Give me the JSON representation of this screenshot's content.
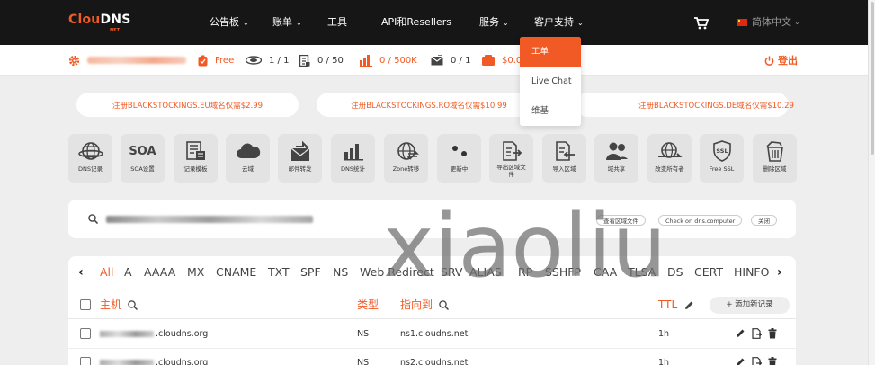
{
  "header": {
    "logo": "ClouDNS",
    "logo_sub": "NET",
    "nav": [
      {
        "label": "公告板",
        "chevron": true
      },
      {
        "label": "账单",
        "chevron": true
      },
      {
        "label": "工具",
        "chevron": false
      },
      {
        "label": "API和Resellers",
        "chevron": false
      },
      {
        "label": "服务",
        "chevron": true
      },
      {
        "label": "客户支持",
        "chevron": true
      }
    ],
    "language": "简体中文"
  },
  "status": {
    "plan": "Free",
    "zones": "1 / 1",
    "records": "0 / 50",
    "queries": "0 / 500K",
    "mail": "0 / 1",
    "balance": "$0.0",
    "logout": "登出"
  },
  "promos": [
    "注册BLACKSTOCKINGS.EU域名仅需$2.99",
    "注册BLACKSTOCKINGS.RO域名仅需$10.99",
    "注册BLACKSTOCKINGS.DE域名仅需$10.29"
  ],
  "support_menu": [
    "工单",
    "Live Chat",
    "维基"
  ],
  "tiles": [
    {
      "icon": "globe-icon",
      "label": "DNS记录"
    },
    {
      "icon": "soa-icon",
      "label": "SOA设置",
      "text": "SOA"
    },
    {
      "icon": "template-icon",
      "label": "记录模板"
    },
    {
      "icon": "cloud-icon",
      "label": "云域"
    },
    {
      "icon": "mail-forward-icon",
      "label": "邮件转发"
    },
    {
      "icon": "bar-chart-icon",
      "label": "DNS统计"
    },
    {
      "icon": "globe-transfer-icon",
      "label": "Zone转移"
    },
    {
      "icon": "dots-icon",
      "label": "更新中"
    },
    {
      "icon": "export-icon",
      "label": "导出区域文件"
    },
    {
      "icon": "import-icon",
      "label": "导入区域"
    },
    {
      "icon": "users-icon",
      "label": "域共享"
    },
    {
      "icon": "change-owner-icon",
      "label": "改变所有者"
    },
    {
      "icon": "ssl-icon",
      "label": "Free SSL"
    },
    {
      "icon": "trash-icon",
      "label": "删除区域"
    }
  ],
  "search": {
    "buttons": [
      "查看区域文件",
      "Check on dns.computer",
      "关闭"
    ]
  },
  "record_tabs": [
    "All",
    "A",
    "AAAA",
    "MX",
    "CNAME",
    "TXT",
    "SPF",
    "NS",
    "Web Redirect",
    "SRV",
    "ALIAS",
    "RP",
    "SSHFP",
    "CAA",
    "TLSA",
    "DS",
    "CERT",
    "HINFO"
  ],
  "table": {
    "headers": {
      "host": "主机",
      "type": "类型",
      "points_to": "指向到",
      "ttl": "TTL",
      "add": "+ 添加新记录"
    },
    "rows": [
      {
        "host_suffix": ".cloudns.org",
        "type": "NS",
        "points_to": "ns1.cloudns.net",
        "ttl": "1h"
      },
      {
        "host_suffix": ".cloudns.org",
        "type": "NS",
        "points_to": "ns2.cloudns.net",
        "ttl": "1h"
      }
    ]
  },
  "watermark": "xiaoliu",
  "colors": {
    "accent": "#f15a24",
    "nav_bg": "#161616",
    "page_bg": "#eeeeee",
    "tile_bg": "#e3e3e3"
  }
}
